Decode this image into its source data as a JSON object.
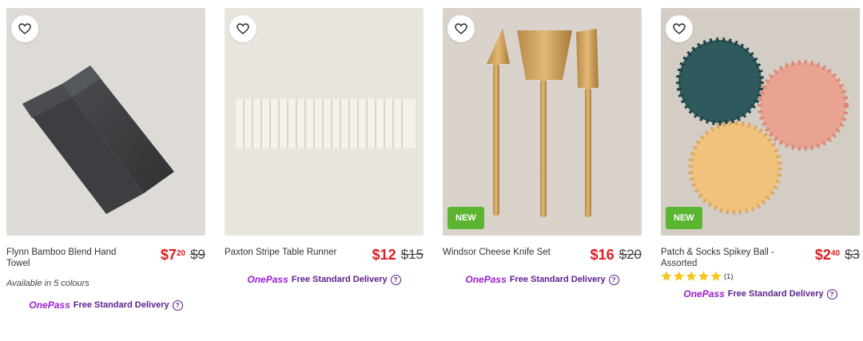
{
  "products": [
    {
      "name": "Flynn Bamboo Blend Hand Towel",
      "price_main": "$7",
      "price_cents": "20",
      "was_price": "$9",
      "colours_note": "Available in 5 colours",
      "onepass_logo": "OnePass",
      "delivery_text": "Free Standard Delivery"
    },
    {
      "name": "Paxton Stripe Table Runner",
      "price_main": "$12",
      "price_cents": "",
      "was_price": "$15",
      "onepass_logo": "OnePass",
      "delivery_text": "Free Standard Delivery"
    },
    {
      "name": "Windsor Cheese Knife Set",
      "badge": "NEW",
      "price_main": "$16",
      "price_cents": "",
      "was_price": "$20",
      "onepass_logo": "OnePass",
      "delivery_text": "Free Standard Delivery"
    },
    {
      "name": "Patch & Socks Spikey Ball - Assorted",
      "badge": "NEW",
      "price_main": "$2",
      "price_cents": "40",
      "was_price": "$3",
      "rating_count": "(1)",
      "rating_stars": 5,
      "onepass_logo": "OnePass",
      "delivery_text": "Free Standard Delivery"
    }
  ],
  "colors": {
    "price": "#e01b22",
    "badge": "#5cb531",
    "onepass": "#9c1dd1",
    "star": "#f5c518"
  },
  "icons": {
    "favourite": "heart-outline-icon",
    "help": "question-circle-icon",
    "rating": "star-icon"
  }
}
